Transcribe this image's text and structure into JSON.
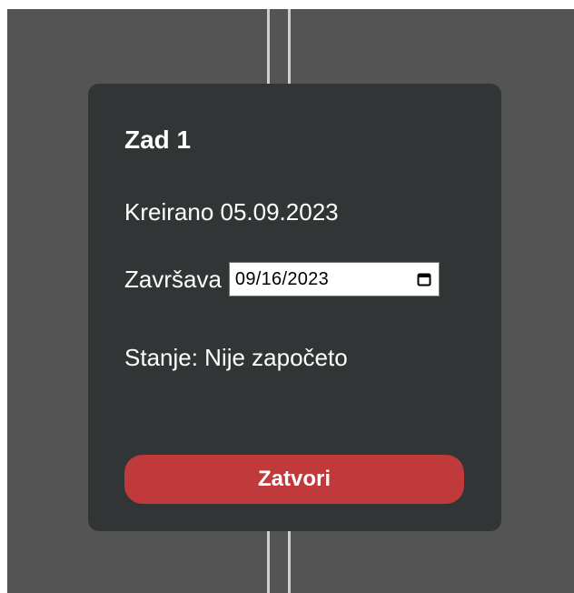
{
  "task": {
    "title": "Zad 1",
    "created_label": "Kreirano 05.09.2023",
    "ends_label": "Završava",
    "ends_date": "09/16/2023",
    "state_label": "Stanje: Nije započeto",
    "close_label": "Zatvori"
  },
  "icons": {
    "date_picker": "calendar-icon"
  },
  "colors": {
    "backdrop": "#545454",
    "card": "#323536",
    "close_button": "#c13a3b",
    "text": "#ffffff"
  }
}
